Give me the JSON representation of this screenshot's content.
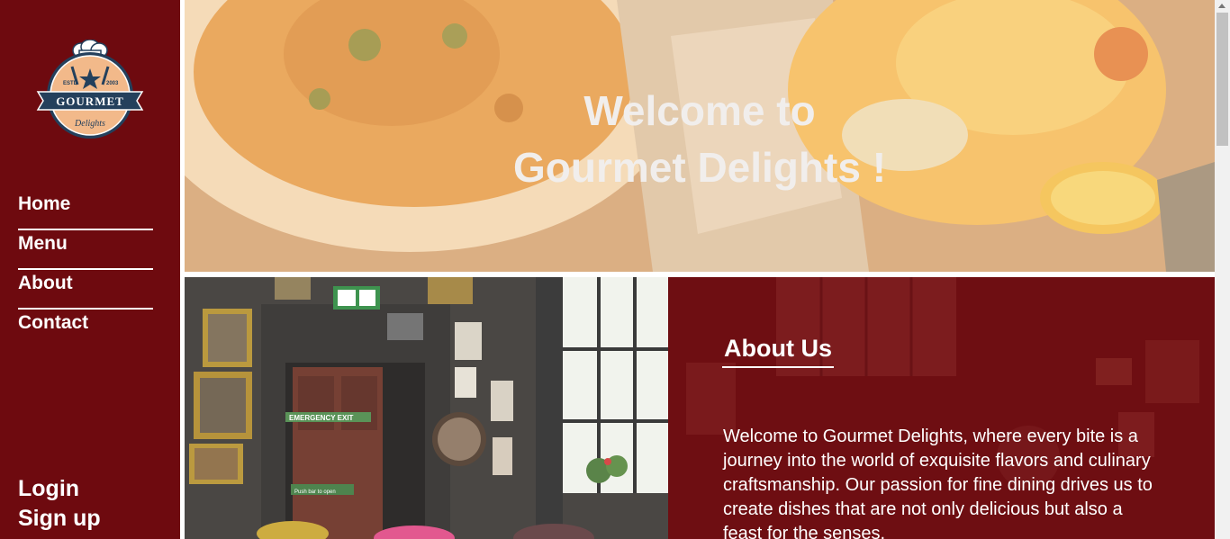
{
  "brand": {
    "logo_name": "GOURMET",
    "logo_script": "Delights",
    "logo_left": "ESTD",
    "logo_right": "2003"
  },
  "nav": {
    "items": [
      {
        "label": "Home"
      },
      {
        "label": "Menu"
      },
      {
        "label": "About"
      },
      {
        "label": "Contact"
      }
    ]
  },
  "auth": {
    "login_label": "Login",
    "signup_label": "Sign up"
  },
  "hero": {
    "title_line1": "Welcome to",
    "title_line2": "Gourmet Delights !"
  },
  "about": {
    "heading": "About Us",
    "text": "Welcome to Gourmet Delights, where every bite is a journey into the world of exquisite flavors and culinary craftsmanship. Our passion for fine dining drives us to create dishes that are not only delicious but also a feast for the senses.",
    "sign_exit": "EMERGENCY EXIT",
    "sign_push": "Push bar to open"
  },
  "colors": {
    "sidebar": "#6e0a0f",
    "about_panel": "#6e0e12",
    "hero_text": "#f1eeec"
  }
}
